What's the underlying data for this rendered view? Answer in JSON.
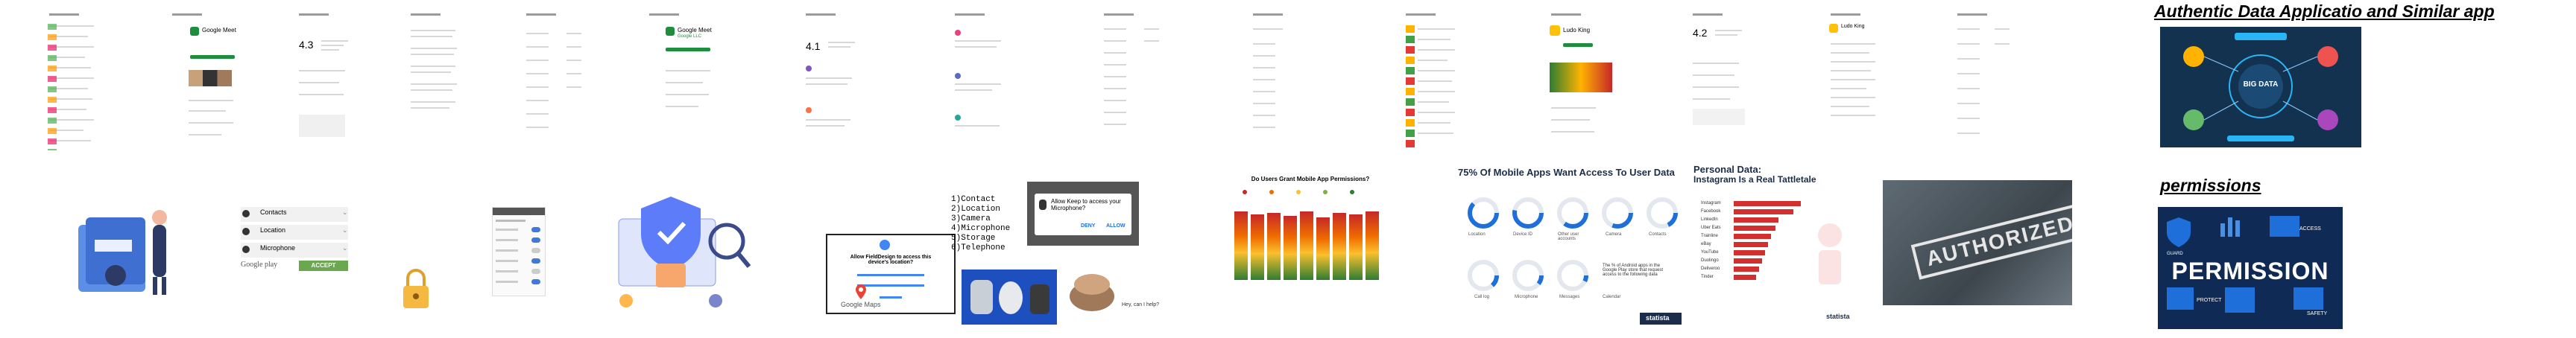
{
  "right_panel": {
    "title": "Authentic Data Applicatio and Similar app",
    "permissions_caption": "permissions"
  },
  "row1_shots": {
    "google_meet": {
      "app_name": "Google Meet"
    },
    "google_meet2": {
      "app_name": "Google Meet",
      "sub": "Google LLC"
    },
    "ludo_king": {
      "app_name": "Ludo King"
    },
    "ludo_king2": {
      "app_name": "Ludo King"
    },
    "ratings": [
      "4.3",
      "4.1",
      "4.2"
    ]
  },
  "big_data_tile": {
    "label": "BIG DATA"
  },
  "location_permissions": {
    "items": [
      "Contacts",
      "Location",
      "Microphone"
    ],
    "store": "Google play",
    "accept_label": "ACCEPT"
  },
  "maps_dialog": {
    "text": "Allow FieldDesign to access this device's location?",
    "app_name": "Google Maps"
  },
  "permission_list": {
    "items": [
      "1)Contact",
      "2)Location",
      "3)Camera",
      "4)Microphone",
      "5)Storage",
      "6)Telephone"
    ]
  },
  "keep_dialog": {
    "text": "Allow Keep to access your Microphone?",
    "deny": "DENY",
    "allow": "ALLOW"
  },
  "voice_tile": {
    "prompt": "Hey, can I help?"
  },
  "chart1": {
    "title": "Do Users Grant Mobile App Permissions?"
  },
  "chart2": {
    "title": "75% Of Mobile Apps Want Access To User Data",
    "source": "statista",
    "labels": [
      "Location",
      "Device ID",
      "Other user accounts",
      "Camera",
      "Contacts",
      "Call log",
      "Microphone",
      "Messages",
      "Calendar"
    ],
    "note": "The % of Android apps in the Google Play store that request access to the following data"
  },
  "chart3": {
    "title_line1": "Personal Data:",
    "title_line2": "Instagram Is a Real Tattletale",
    "source": "statista",
    "apps": [
      "Instagram",
      "Facebook",
      "LinkedIn",
      "Uber Eats",
      "Trainline",
      "eBay",
      "YouTube",
      "Duolingo",
      "Deliveroo",
      "Tinder"
    ]
  },
  "authorized_tile": {
    "stamp": "AUTHORIZED"
  },
  "permission_tile": {
    "big": "PERMISSION",
    "guard": "GUARD",
    "protect": "PROTECT",
    "safety": "SAFETY",
    "access": "ACCESS"
  },
  "colors": {
    "google_green": "#1e8e3e",
    "dark_navy": "#1b2d4a",
    "accent_blue": "#1e6fd9",
    "red": "#d32f2f"
  }
}
